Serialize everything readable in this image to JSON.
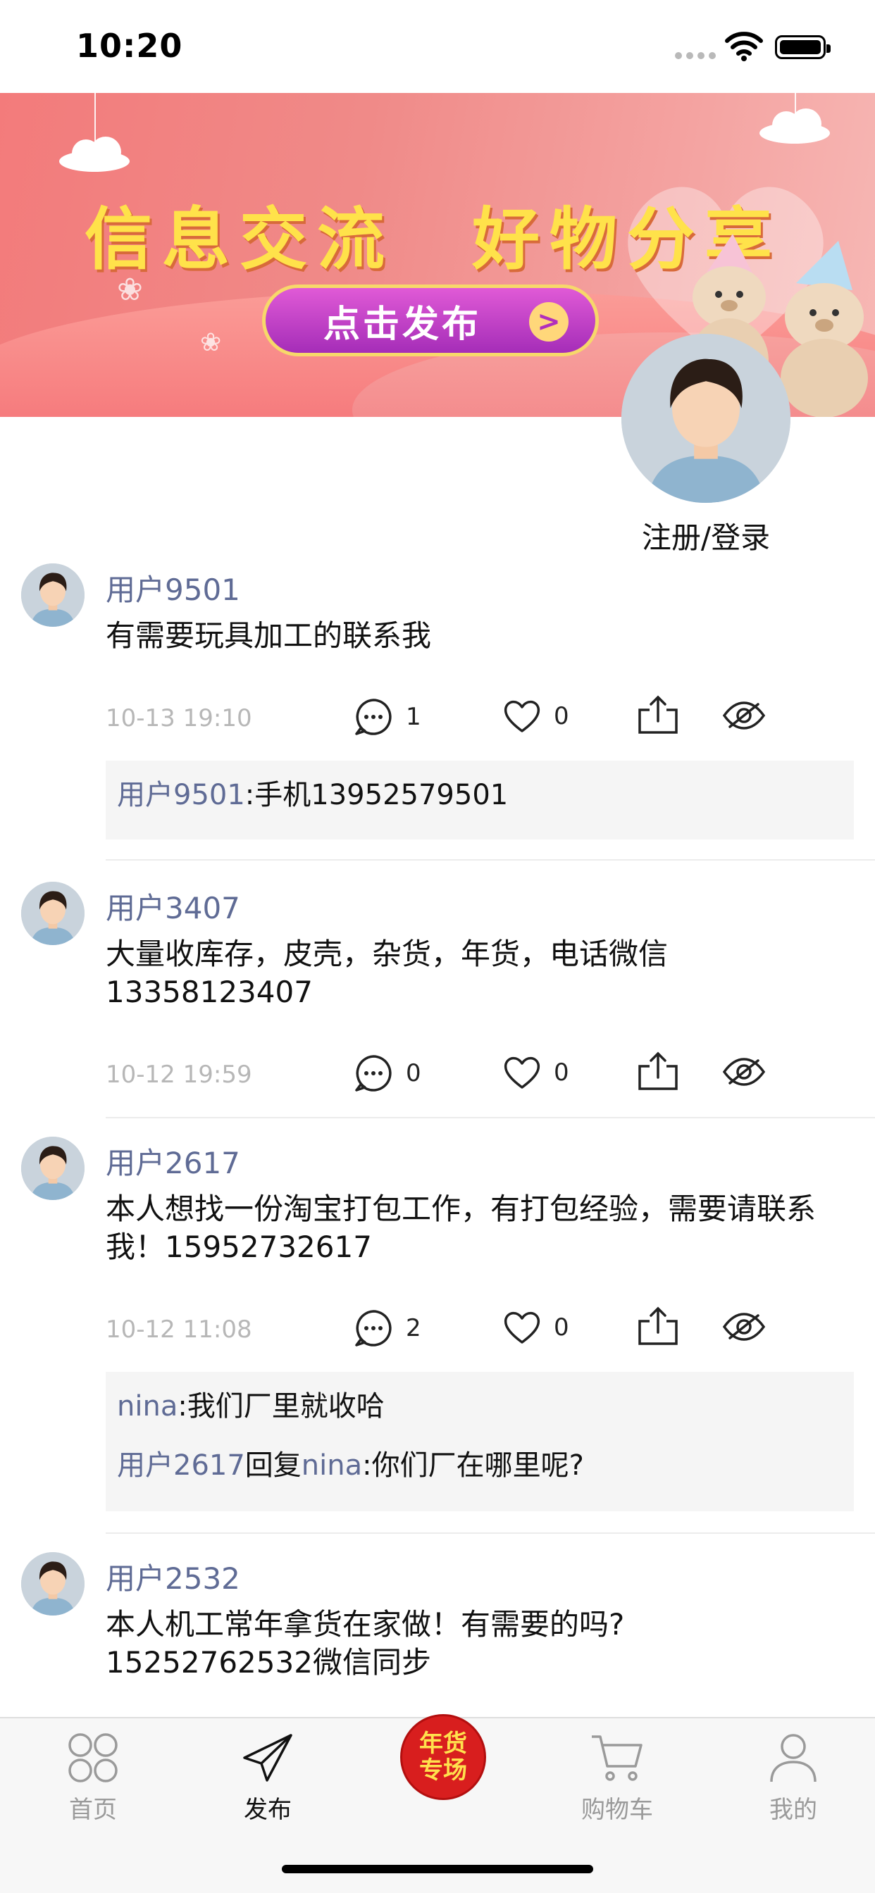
{
  "status_bar": {
    "time": "10:20"
  },
  "banner": {
    "title": "信息交流　好物分享",
    "publish_button": "点击发布",
    "arrow": ">"
  },
  "login": {
    "label": "注册/登录"
  },
  "posts": [
    {
      "username": "用户9501",
      "content": "有需要玩具加工的联系我",
      "time": "10-13 19:10",
      "comment_count": "1",
      "like_count": "0",
      "comments": [
        {
          "name": "用户9501",
          "text": ":手机13952579501"
        }
      ]
    },
    {
      "username": "用户3407",
      "content": "大量收库存，皮壳，杂货，年货，电话微信13358123407",
      "time": "10-12 19:59",
      "comment_count": "0",
      "like_count": "0",
      "comments": []
    },
    {
      "username": "用户2617",
      "content": "本人想找一份淘宝打包工作，有打包经验，需要请联系我！15952732617",
      "time": "10-12 11:08",
      "comment_count": "2",
      "like_count": "0",
      "comments": [
        {
          "name": "nina",
          "text": ":我们厂里就收哈"
        },
        {
          "name": "用户2617",
          "mid": "回复",
          "name2": "nina",
          "text": ":你们厂在哪里呢?"
        }
      ]
    },
    {
      "username": "用户2532",
      "content": "本人机工常年拿货在家做！有需要的吗?15252762532微信同步"
    }
  ],
  "tabbar": {
    "home": "首页",
    "publish": "发布",
    "special_line1": "年货",
    "special_line2": "专场",
    "cart": "购物车",
    "mine": "我的"
  },
  "colors": {
    "username": "#5f6b95",
    "banner_title": "#ffe24a",
    "publish_button": "#c13ec8",
    "special_badge": "#d81e1e"
  }
}
